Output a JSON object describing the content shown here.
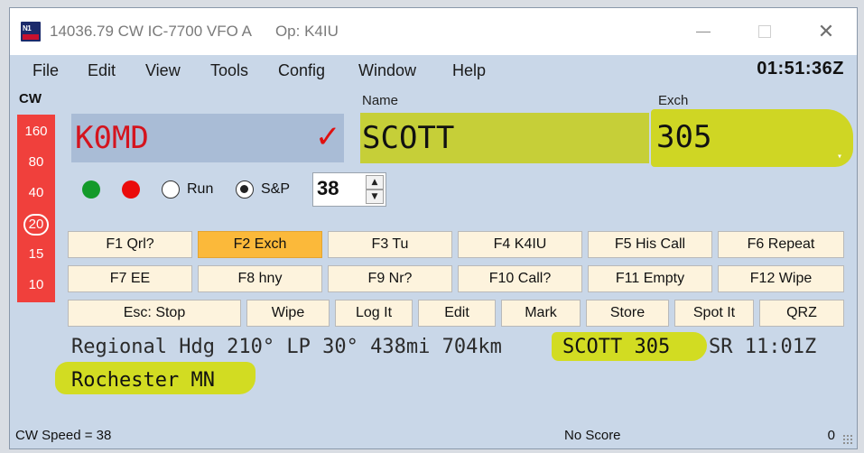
{
  "window": {
    "title": "14036.79 CW IC-7700 VFO A",
    "operator": "Op: K4IU"
  },
  "menu": {
    "items": [
      "File",
      "Edit",
      "View",
      "Tools",
      "Config",
      "Window",
      "Help"
    ]
  },
  "clock": "01:51:36Z",
  "mode": "CW",
  "bands": [
    "160",
    "80",
    "40",
    "20",
    "15",
    "10"
  ],
  "selected_band": "20",
  "fields": {
    "name_label": "Name",
    "exch_label": "Exch",
    "call_value": "K0MD",
    "name_value": "SCOTT",
    "exch_value": "305"
  },
  "controls": {
    "run_label": "Run",
    "sp_label": "S&P",
    "speed_value": "38"
  },
  "function_keys": {
    "row1": [
      "F1 Qrl?",
      "F2 Exch",
      "F3 Tu",
      "F4 K4IU",
      "F5 His Call",
      "F6 Repeat"
    ],
    "row2": [
      "F7 EE",
      "F8 hny",
      "F9 Nr?",
      "F10 Call?",
      "F11 Empty",
      "F12 Wipe"
    ],
    "row3": [
      "Esc: Stop",
      "Wipe",
      "Log It",
      "Edit",
      "Mark",
      "Store",
      "Spot It",
      "QRZ"
    ],
    "active": "F2 Exch"
  },
  "info": {
    "line1_prefix": "Regional Hdg 210° LP 30° 438mi 704km",
    "line1_highlight": "SCOTT 305",
    "line1_suffix": "SR 11:01Z",
    "line2": "Rochester MN"
  },
  "status": {
    "left": "CW Speed = 38",
    "middle": "No Score",
    "right": "0"
  },
  "colors": {
    "call_text": "#d4141e",
    "band_panel": "#f0403c",
    "highlight": "#d2dc22",
    "active_key": "#fbb93a"
  }
}
